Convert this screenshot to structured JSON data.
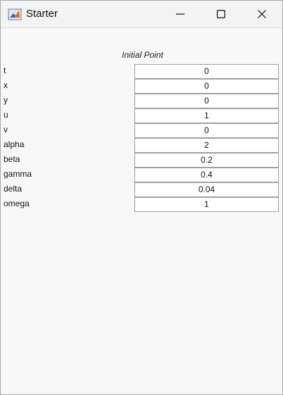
{
  "window": {
    "title": "Starter"
  },
  "panel": {
    "heading": "Initial Point",
    "rows": [
      {
        "label": "t",
        "value": "0"
      },
      {
        "label": "x",
        "value": "0"
      },
      {
        "label": "y",
        "value": "0"
      },
      {
        "label": "u",
        "value": "1"
      },
      {
        "label": "v",
        "value": "0"
      },
      {
        "label": "alpha",
        "value": "2"
      },
      {
        "label": "beta",
        "value": "0.2"
      },
      {
        "label": "gamma",
        "value": "0.4"
      },
      {
        "label": "delta",
        "value": "0.04"
      },
      {
        "label": "omega",
        "value": "1"
      }
    ]
  },
  "icons": {
    "app": "matlab-logo-icon",
    "minimize": "minimize-icon",
    "maximize": "maximize-icon",
    "close": "close-icon"
  }
}
